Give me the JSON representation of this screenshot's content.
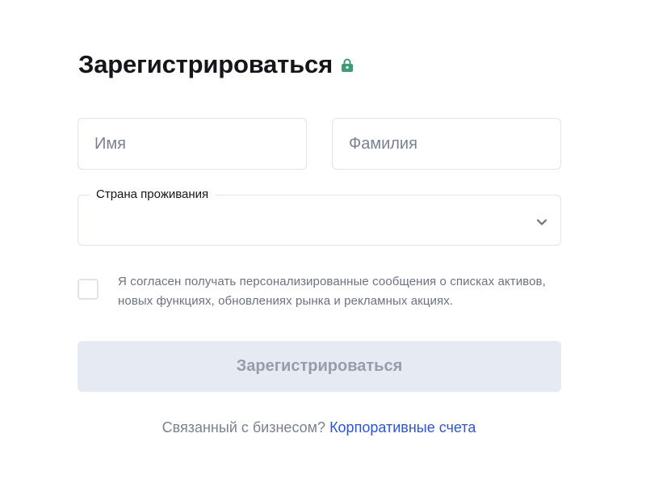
{
  "header": {
    "title": "Зарегистрироваться",
    "lock_icon": "lock-icon",
    "lock_color": "#3d9c77"
  },
  "form": {
    "first_name": {
      "value": "",
      "placeholder": "Имя"
    },
    "last_name": {
      "value": "",
      "placeholder": "Фамилия"
    },
    "country": {
      "label": "Страна проживания",
      "value": "",
      "icon": "chevron-down-icon"
    },
    "consent": {
      "checked": false,
      "text": "Я согласен получать персонализированные сообщения о списках активов, новых функциях, обновлениях рынка и рекламных акциях."
    },
    "submit_label": "Зарегистрироваться"
  },
  "footer": {
    "question": "Связанный с бизнесом?",
    "link_label": "Корпоративные счета"
  },
  "colors": {
    "link": "#2f55d4",
    "button_disabled_bg": "#e6ebf3",
    "button_disabled_text": "#959cab",
    "border": "#dfe3ea"
  }
}
